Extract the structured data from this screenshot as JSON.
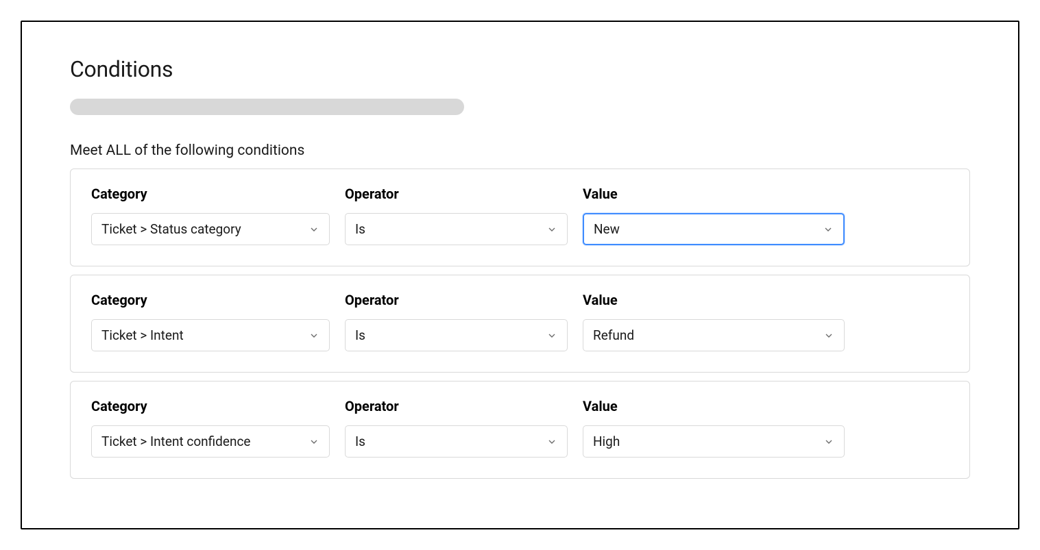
{
  "header": {
    "title": "Conditions"
  },
  "subtitle": "Meet ALL of the following conditions",
  "labels": {
    "category": "Category",
    "operator": "Operator",
    "value": "Value"
  },
  "rows": [
    {
      "category": "Ticket > Status category",
      "operator": "Is",
      "value": "New",
      "value_focused": true
    },
    {
      "category": "Ticket > Intent",
      "operator": "Is",
      "value": "Refund",
      "value_focused": false
    },
    {
      "category": "Ticket > Intent confidence",
      "operator": "Is",
      "value": "High",
      "value_focused": false
    }
  ]
}
